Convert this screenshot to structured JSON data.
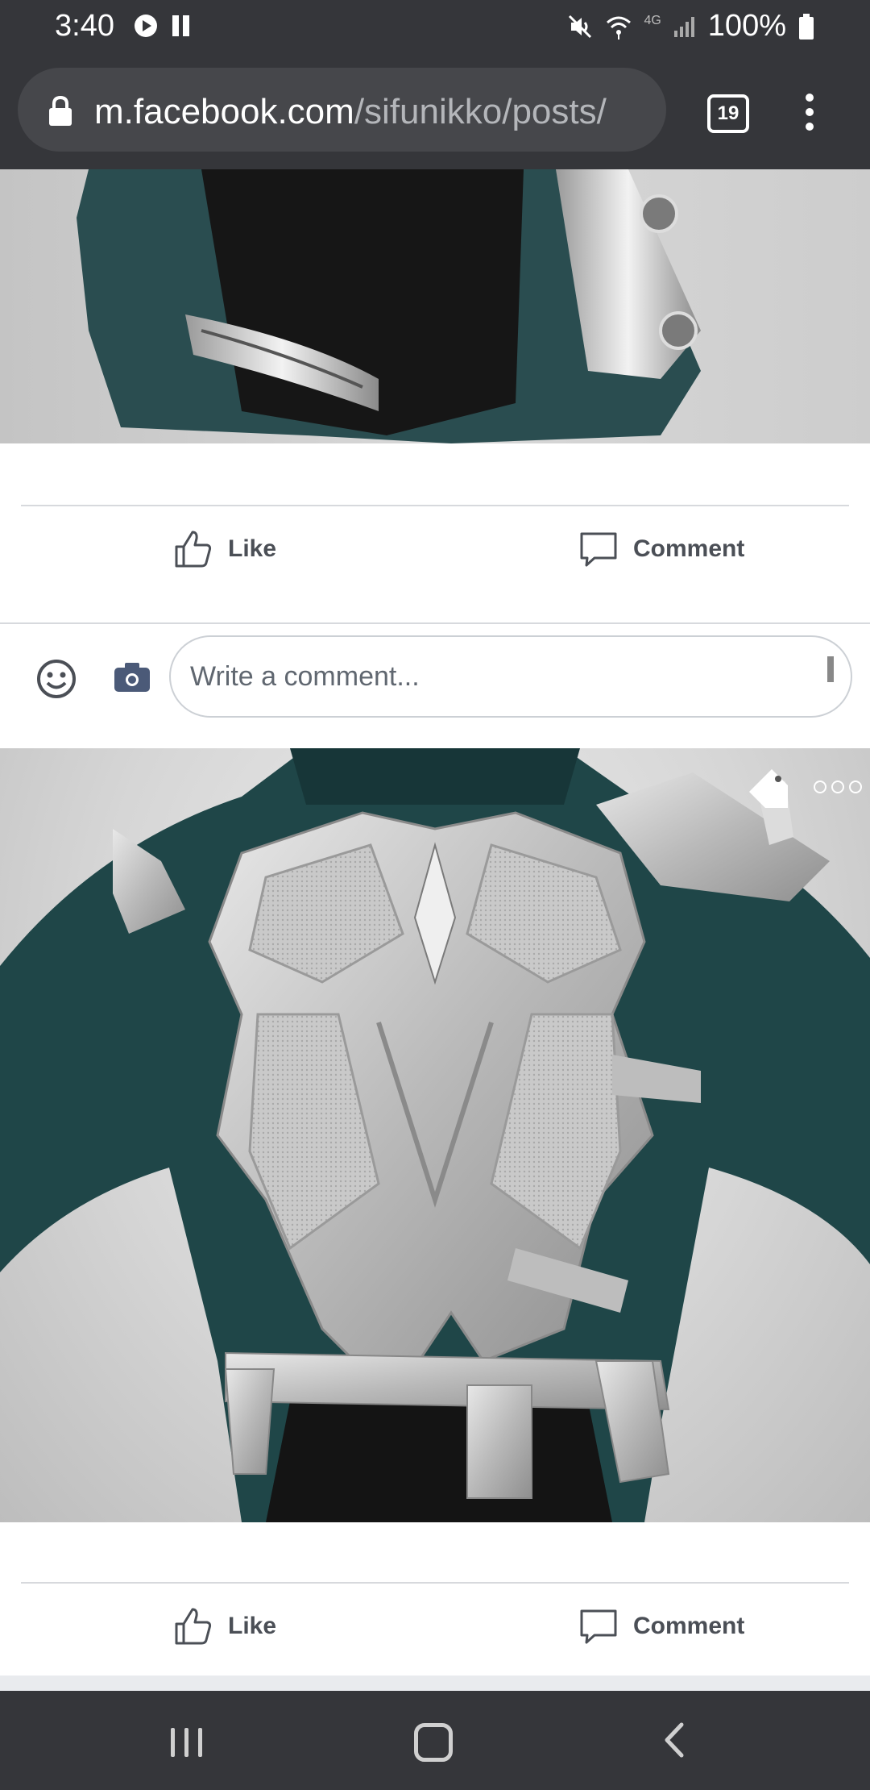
{
  "status_bar": {
    "time": "3:40",
    "battery": "100%",
    "network": "4G"
  },
  "browser": {
    "url_host": "m.facebook.com",
    "url_path": "/sifunikko/posts/",
    "tab_count": "19"
  },
  "post1": {
    "like_label": "Like",
    "comment_label": "Comment",
    "comment_placeholder": "Write a comment..."
  },
  "post2": {
    "like_label": "Like",
    "comment_label": "Comment"
  },
  "colors": {
    "chrome": "#35363a",
    "action_text": "#4b4f56",
    "suit_teal": "#1f4648",
    "armor_silver": "#c8c8c8"
  }
}
